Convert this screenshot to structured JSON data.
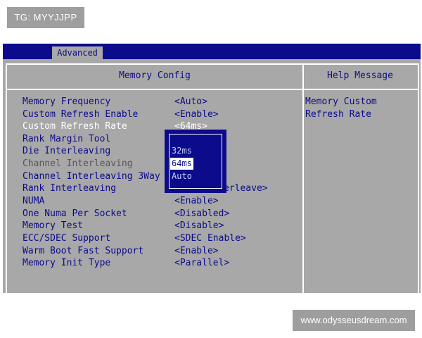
{
  "watermark_tag": "TG: MYYJJPP",
  "watermark_site": "www.odysseusdream.com",
  "bios": {
    "tab": "Advanced",
    "main_title": "Memory Config",
    "help_title": "Help Message",
    "help_text": "Memory Custom\nRefresh Rate",
    "settings": [
      {
        "label": "Memory Frequency",
        "value": "<Auto>"
      },
      {
        "label": "Custom Refresh Enable",
        "value": "<Enable>"
      },
      {
        "label": "Custom Refresh Rate",
        "value": "<64ms>"
      },
      {
        "label": "Rank Margin Tool",
        "value": ""
      },
      {
        "label": "Die Interleaving",
        "value": ""
      },
      {
        "label": "Channel Interleaving",
        "value": ""
      },
      {
        "label": "Channel Interleaving 3Way",
        "value": ""
      },
      {
        "label": "Rank Interleaving",
        "value": "erleave>"
      },
      {
        "label": "NUMA",
        "value": "<Enable>"
      },
      {
        "label": "One Numa Per Socket",
        "value": "<Disabled>"
      },
      {
        "label": "Memory Test",
        "value": "<Disable>"
      },
      {
        "label": "ECC/SDEC Support",
        "value": "<SDEC Enable>"
      },
      {
        "label": "Warm Boot Fast Support",
        "value": "<Enable>"
      },
      {
        "label": "Memory Init Type",
        "value": "<Parallel>"
      }
    ],
    "popup_options": [
      "32ms",
      "64ms",
      "Auto"
    ]
  },
  "colors": {
    "bios_blue": "#0b0b8c",
    "bios_gray": "#a8a8a8",
    "highlight": "#ffffff"
  }
}
